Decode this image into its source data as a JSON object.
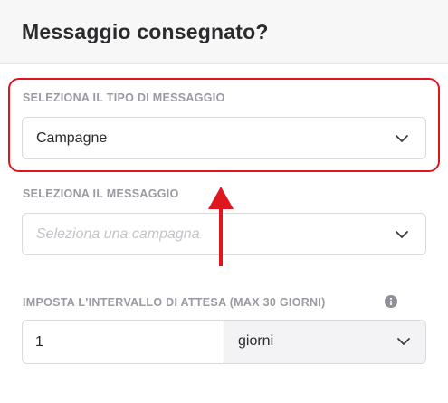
{
  "header": {
    "title": "Messaggio consegnato?"
  },
  "message_type": {
    "label": "SELEZIONA IL TIPO DI MESSAGGIO",
    "value": "Campagne",
    "icon": "chevron-down-icon"
  },
  "message": {
    "label": "SELEZIONA IL MESSAGGIO",
    "placeholder": "Seleziona una campagna",
    "icon": "chevron-down-icon"
  },
  "interval": {
    "label": "IMPOSTA L'INTERVALLO DI ATTESA (MAX 30 GIORNI)",
    "info_icon": "info-icon",
    "value": "1",
    "unit": "giorni",
    "unit_icon": "chevron-down-icon"
  },
  "annotation": {
    "highlight_color": "#e0161e",
    "arrow_icon": "arrow-up-icon"
  }
}
